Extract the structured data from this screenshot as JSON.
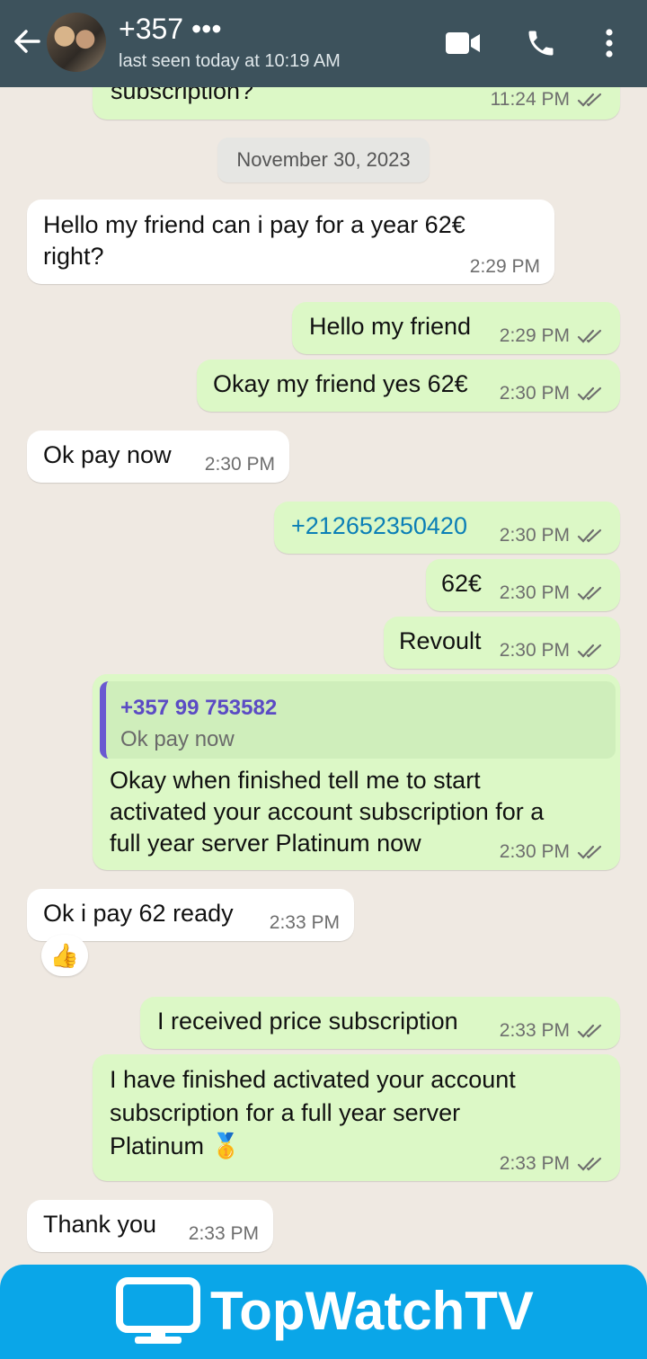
{
  "header": {
    "contact_name": "+357 •••",
    "status": "last seen today at 10:19 AM"
  },
  "chat": {
    "messages": [
      {
        "text": "subscription?",
        "time": "11:24 PM"
      },
      {
        "date_separator": "November 30, 2023"
      },
      {
        "text": "Hello my friend can i pay for a year 62€\nright?",
        "time": "2:29 PM"
      },
      {
        "text": "Hello my friend",
        "time": "2:29 PM"
      },
      {
        "text": "Okay my friend yes 62€",
        "time": "2:30 PM"
      },
      {
        "text": "Ok pay now",
        "time": "2:30 PM"
      },
      {
        "text": "+212652350420",
        "time": "2:30 PM"
      },
      {
        "text": "62€",
        "time": "2:30 PM"
      },
      {
        "text": "Revoult",
        "time": "2:30 PM"
      },
      {
        "quote_author": "+357 99 753582",
        "quote_text": "Ok pay now",
        "text": "Okay when finished tell me to start\nactivated your account subscription for a\nfull year server Platinum now",
        "time": "2:30 PM"
      },
      {
        "text": "Ok i pay 62 ready",
        "time": "2:33 PM",
        "reaction": "👍"
      },
      {
        "text": "I received price subscription",
        "time": "2:33 PM"
      },
      {
        "text": "I have finished activated your account\nsubscription for a full year server\nPlatinum 🥇",
        "time": "2:33 PM"
      },
      {
        "text": "Thank you",
        "time": "2:33 PM"
      }
    ]
  },
  "banner": {
    "brand": "TopWatchTV"
  },
  "colors": {
    "header_bg": "#3d525c",
    "outgoing_bubble": "#dcf8c6",
    "incoming_bubble": "#ffffff",
    "read_ticks": "#6e6e6e",
    "banner_bg": "#0aa6e8"
  },
  "icons": [
    "back-arrow-icon",
    "video-call-icon",
    "phone-icon",
    "more-options-icon",
    "double-tick-icon",
    "tv-logo-icon"
  ]
}
